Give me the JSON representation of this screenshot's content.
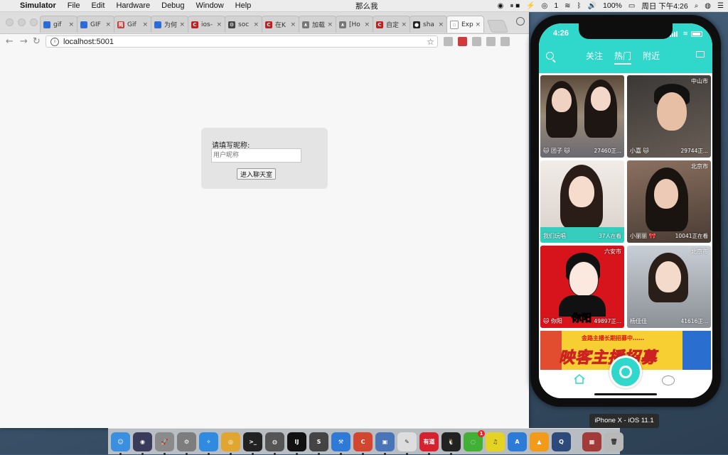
{
  "menubar": {
    "app": "Simulator",
    "items": [
      "File",
      "Edit",
      "Hardware",
      "Debug",
      "Window",
      "Help"
    ],
    "center_user": "那么我",
    "battery": "100%",
    "clock": "周日 下午4:26",
    "notif_count": "1"
  },
  "browser": {
    "tabs": [
      {
        "label": "gif",
        "fav_color": "#2f6ce0",
        "fav_glyph": "🐾"
      },
      {
        "label": "GIF",
        "fav_color": "#2f6ce0",
        "fav_glyph": "🐾"
      },
      {
        "label": "Gif",
        "fav_color": "#c83a3a",
        "fav_glyph": "简"
      },
      {
        "label": "为何",
        "fav_color": "#2f6ce0",
        "fav_glyph": "🐾"
      },
      {
        "label": "ios-",
        "fav_color": "#c81c1c",
        "fav_glyph": "C"
      },
      {
        "label": "soc",
        "fav_color": "#444444",
        "fav_glyph": "⚙"
      },
      {
        "label": "在K",
        "fav_color": "#c81c1c",
        "fav_glyph": "C"
      },
      {
        "label": "加载",
        "fav_color": "#777777",
        "fav_glyph": "∧"
      },
      {
        "label": "[Ho",
        "fav_color": "#777777",
        "fav_glyph": "∧"
      },
      {
        "label": "自定",
        "fav_color": "#c81c1c",
        "fav_glyph": "C"
      },
      {
        "label": "sha",
        "fav_color": "#222222",
        "fav_glyph": "●"
      },
      {
        "label": "Exp",
        "fav_color": "#ffffff",
        "fav_glyph": "▫",
        "active": true
      }
    ],
    "url": "localhost:5001"
  },
  "page": {
    "nickname_label": "请填写昵称:",
    "nickname_placeholder": "用户昵称",
    "enter_button": "进入聊天室"
  },
  "phone": {
    "time": "4:26",
    "tabs": [
      "关注",
      "热门",
      "附近"
    ],
    "active_tab": "热门",
    "accent": "#2fd8cb",
    "cells": [
      {
        "city": "",
        "nick": "🐱 团子 🐱",
        "view": "27460正..."
      },
      {
        "city": "中山市",
        "nick": "小嘉 🐱",
        "view": "29744正..."
      },
      {
        "city": "",
        "nick": "我们玩唱",
        "view": "37人在看"
      },
      {
        "city": "北京市",
        "nick": "小丽丽 🎀",
        "view": "10041正在看"
      },
      {
        "city": "六安市",
        "nick": "🐱 你阳",
        "view": "49897正..."
      },
      {
        "city": "北京市",
        "nick": "杨佳佳",
        "view": "41616正..."
      }
    ],
    "cell5_caption": "你阳",
    "banner_top": "金路主播长期招募中……",
    "banner_title": "映客主播招募"
  },
  "simulator_label": "iPhone X - iOS 11.1",
  "dock": {
    "apps": [
      {
        "name": "finder",
        "color": "#3b8fe0",
        "glyph": "☺"
      },
      {
        "name": "siri",
        "color": "#3a3a5a",
        "glyph": "◉"
      },
      {
        "name": "launchpad",
        "color": "#8a8a8a",
        "glyph": "🚀"
      },
      {
        "name": "system-preferences",
        "color": "#7d7d7d",
        "glyph": "⚙"
      },
      {
        "name": "safari",
        "color": "#2f8ae0",
        "glyph": "✧"
      },
      {
        "name": "chrome",
        "color": "#e0a62f",
        "glyph": "◎"
      },
      {
        "name": "terminal",
        "color": "#222222",
        "glyph": ">_"
      },
      {
        "name": "camera",
        "color": "#555555",
        "glyph": "◍"
      },
      {
        "name": "intellij",
        "color": "#111111",
        "glyph": "IJ"
      },
      {
        "name": "sublime",
        "color": "#444444",
        "glyph": "S"
      },
      {
        "name": "xcode",
        "color": "#2f7ad6",
        "glyph": "⚒"
      },
      {
        "name": "clion",
        "color": "#d2452f",
        "glyph": "C"
      },
      {
        "name": "preview",
        "color": "#4a74b8",
        "glyph": "▣"
      },
      {
        "name": "textedit",
        "color": "#dddddd",
        "glyph": "✎"
      },
      {
        "name": "youdao",
        "color": "#d6222f",
        "glyph": "有道"
      },
      {
        "name": "qq",
        "color": "#222222",
        "glyph": "🐧"
      },
      {
        "name": "wechat",
        "color": "#41b035",
        "glyph": "◌",
        "badge": "1"
      },
      {
        "name": "music",
        "color": "#e5d323",
        "glyph": "♫"
      },
      {
        "name": "app-store",
        "color": "#2c7bd6",
        "glyph": "A"
      },
      {
        "name": "vlc",
        "color": "#f29a1a",
        "glyph": "▲"
      },
      {
        "name": "quicktime",
        "color": "#2d4a7a",
        "glyph": "Q"
      },
      {
        "name": "photo-booth",
        "color": "#a23a3a",
        "glyph": "▦"
      },
      {
        "name": "trash",
        "color": "#b8b8b8",
        "glyph": "🗑"
      }
    ]
  }
}
